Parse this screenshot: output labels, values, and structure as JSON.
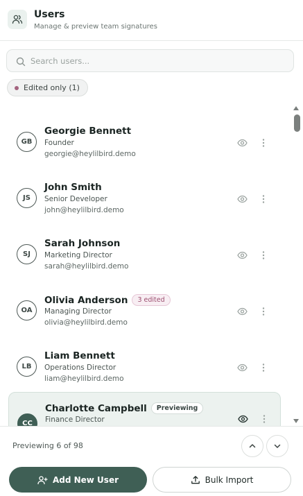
{
  "header": {
    "title": "Users",
    "subtitle": "Manage & preview team signatures",
    "icon": "users-icon"
  },
  "search": {
    "placeholder": "Search users...",
    "value": ""
  },
  "filter": {
    "label": "Edited only (1)",
    "dot_color": "#a3637f"
  },
  "users": [
    {
      "initials": "GB",
      "name": "Georgie Bennett",
      "role": "Founder",
      "email": "georgie@heylilbird.demo",
      "badge": ""
    },
    {
      "initials": "JS",
      "name": "John Smith",
      "role": "Senior Developer",
      "email": "john@heylilbird.demo",
      "badge": ""
    },
    {
      "initials": "SJ",
      "name": "Sarah Johnson",
      "role": "Marketing Director",
      "email": "sarah@heylilbird.demo",
      "badge": ""
    },
    {
      "initials": "OA",
      "name": "Olivia Anderson",
      "role": "Managing Director",
      "email": "olivia@heylilbird.demo",
      "badge": "3 edited"
    },
    {
      "initials": "LB",
      "name": "Liam Bennett",
      "role": "Operations Director",
      "email": "liam@heylilbird.demo",
      "badge": ""
    },
    {
      "initials": "CC",
      "name": "Charlotte Campbell",
      "role": "Finance Director",
      "email": "",
      "badge": "Previewing"
    }
  ],
  "footer": {
    "preview_count": "Previewing 6 of 98",
    "add_button": "Add New User",
    "import_button": "Bulk Import"
  },
  "colors": {
    "accent": "#3f5f55",
    "active_row": "#ecf2ef",
    "edited_badge": "#9b4d6e"
  }
}
